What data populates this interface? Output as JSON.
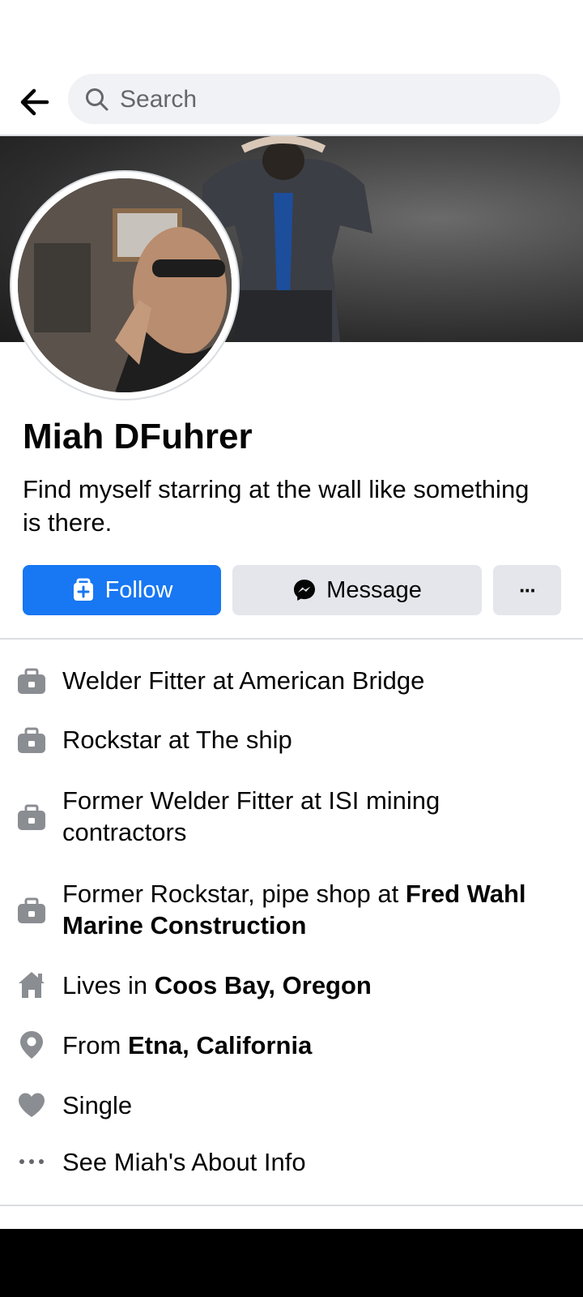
{
  "search": {
    "placeholder": "Search"
  },
  "profile": {
    "name": "Miah DFuhrer",
    "bio": "Find myself starring at the wall like something is there."
  },
  "actions": {
    "follow_label": "Follow",
    "message_label": "Message",
    "more_label": "···"
  },
  "about": {
    "items": [
      {
        "icon": "briefcase-icon",
        "text": "Welder Fitter at American Bridge"
      },
      {
        "icon": "briefcase-icon",
        "text": "Rockstar at The ship"
      },
      {
        "icon": "briefcase-icon",
        "text": "Former Welder Fitter at ISI mining contractors"
      },
      {
        "icon": "briefcase-icon",
        "prefix": "Former Rockstar, pipe shop at ",
        "bold": "Fred Wahl Marine Construction"
      },
      {
        "icon": "home-icon",
        "prefix": "Lives in ",
        "bold": "Coos Bay, Oregon"
      },
      {
        "icon": "location-pin-icon",
        "prefix": "From ",
        "bold": "Etna, California"
      },
      {
        "icon": "heart-icon",
        "text": "Single"
      },
      {
        "icon": "more-dots-icon",
        "text": "See Miah's About Info"
      }
    ]
  },
  "colors": {
    "accent": "#1877f2",
    "button_secondary": "#e4e6eb",
    "icon_gray": "#8a8d91",
    "search_bg": "#f0f2f5"
  }
}
